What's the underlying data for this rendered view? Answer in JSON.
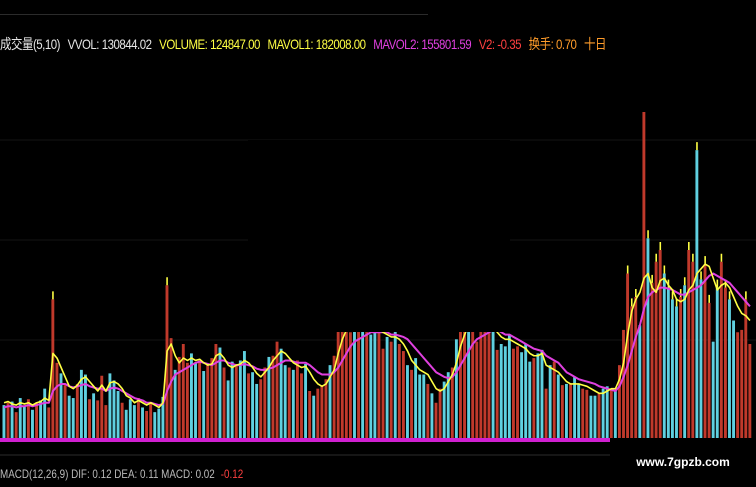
{
  "legend": {
    "indicator": "成交量(5,10)",
    "vvol": "VVOL: 130844.02",
    "volume": "VOLUME: 124847.00",
    "mavol1": "MAVOL1: 182008.00",
    "mavol2": "MAVOL2: 155801.59",
    "v2": "V2: -0.35",
    "turnover": "换手: 0.70",
    "ten_day": "十日"
  },
  "bottom_legend": {
    "label": "MACD(12,26,9) DIF: 0.12 DEA: 0.11 MACD: 0.02",
    "extra": "-0.12"
  },
  "watermark": "www.7gpzb.com",
  "colors": {
    "background": "#000000",
    "up_bar": "#c0392b",
    "down_bar": "#5fd0e0",
    "ma_short": "#ffff44",
    "ma_long": "#e040e0",
    "baseline": "#d020d0",
    "spike": "#ffff44",
    "legend_white": "#e6e6e6",
    "legend_yellow": "#ffff44",
    "legend_magenta": "#e040e0",
    "legend_red": "#ff4040",
    "legend_orange": "#ff9c2a"
  },
  "chart_data": {
    "type": "bar",
    "title": "",
    "xlabel": "",
    "ylabel": "",
    "ylim": [
      0,
      320
    ],
    "grid": true,
    "series": [
      {
        "name": "VOLUME",
        "values": [
          28,
          30,
          31,
          22,
          34,
          27,
          33,
          24,
          30,
          32,
          42,
          26,
          118,
          64,
          55,
          45,
          36,
          34,
          46,
          58,
          54,
          33,
          38,
          32,
          53,
          28,
          55,
          49,
          40,
          30,
          24,
          33,
          28,
          34,
          26,
          23,
          30,
          22,
          25,
          35,
          130,
          85,
          58,
          69,
          80,
          64,
          72,
          64,
          66,
          57,
          62,
          68,
          80,
          77,
          60,
          49,
          65,
          63,
          66,
          74,
          55,
          56,
          46,
          50,
          60,
          69,
          70,
          82,
          76,
          62,
          60,
          58,
          66,
          55,
          63,
          40,
          36,
          42,
          45,
          50,
          62,
          70,
          95,
          98,
          105,
          90,
          95,
          100,
          102,
          98,
          88,
          92,
          92,
          76,
          86,
          82,
          92,
          80,
          74,
          62,
          58,
          68,
          54,
          54,
          46,
          38,
          30,
          42,
          48,
          56,
          60,
          84,
          92,
          102,
          104,
          92,
          82,
          104,
          102,
          100,
          93,
          75,
          80,
          78,
          88,
          76,
          78,
          73,
          80,
          65,
          68,
          72,
          75,
          42,
          62,
          65,
          54,
          45,
          46,
          46,
          52,
          46,
          42,
          41,
          36,
          36,
          38,
          42,
          44,
          42,
          40,
          62,
          92,
          140,
          112,
          120,
          96,
          280,
          170,
          132,
          150,
          160,
          140,
          128,
          118,
          112,
          120,
          130,
          160,
          150,
          245,
          135,
          148,
          115,
          82,
          128,
          150,
          128,
          118,
          100,
          90,
          92,
          118,
          80
        ],
        "up": [
          0,
          1,
          0,
          1,
          0,
          0,
          1,
          0,
          1,
          0,
          0,
          1,
          1,
          1,
          0,
          1,
          0,
          0,
          1,
          0,
          0,
          1,
          0,
          1,
          1,
          1,
          0,
          0,
          0,
          1,
          0,
          0,
          0,
          1,
          0,
          1,
          1,
          0,
          0,
          0,
          1,
          1,
          0,
          1,
          1,
          1,
          0,
          0,
          1,
          0,
          1,
          1,
          1,
          0,
          1,
          0,
          0,
          1,
          0,
          0,
          1,
          0,
          0,
          1,
          1,
          0,
          1,
          1,
          0,
          0,
          1,
          0,
          1,
          1,
          0,
          1,
          0,
          1,
          1,
          1,
          0,
          1,
          1,
          1,
          1,
          1,
          0,
          1,
          0,
          1,
          0,
          0,
          1,
          1,
          0,
          1,
          0,
          1,
          1,
          0,
          1,
          0,
          0,
          0,
          1,
          0,
          1,
          1,
          0,
          0,
          1,
          0,
          1,
          1,
          0,
          1,
          1,
          1,
          1,
          1,
          0,
          1,
          0,
          0,
          0,
          1,
          1,
          0,
          0,
          0,
          1,
          0,
          0,
          1,
          0,
          1,
          0,
          1,
          0,
          1,
          0,
          0,
          1,
          1,
          0,
          0,
          1,
          0,
          0,
          1,
          0,
          1,
          1,
          1,
          1,
          1,
          0,
          1,
          0,
          1,
          1,
          1,
          0,
          0,
          0,
          0,
          1,
          0,
          1,
          1,
          0,
          0,
          1,
          1,
          0,
          0,
          1,
          1,
          0,
          0,
          1,
          1,
          1,
          1
        ]
      },
      {
        "name": "MAVOL1",
        "values": [
          30,
          31,
          29,
          28,
          30,
          29,
          30,
          28,
          30,
          31,
          34,
          32,
          72,
          68,
          60,
          52,
          44,
          42,
          45,
          50,
          52,
          48,
          44,
          40,
          45,
          40,
          47,
          48,
          46,
          42,
          36,
          34,
          30,
          32,
          30,
          28,
          30,
          28,
          26,
          30,
          74,
          80,
          70,
          64,
          68,
          66,
          68,
          66,
          67,
          64,
          62,
          63,
          70,
          72,
          68,
          62,
          60,
          62,
          63,
          66,
          64,
          60,
          55,
          52,
          56,
          60,
          66,
          70,
          74,
          72,
          68,
          64,
          62,
          60,
          61,
          56,
          50,
          46,
          44,
          46,
          52,
          58,
          72,
          84,
          92,
          96,
          98,
          96,
          98,
          98,
          96,
          94,
          92,
          90,
          88,
          86,
          86,
          84,
          80,
          74,
          66,
          62,
          58,
          56,
          54,
          48,
          42,
          40,
          42,
          48,
          54,
          64,
          78,
          88,
          96,
          98,
          94,
          92,
          94,
          96,
          94,
          90,
          86,
          84,
          84,
          82,
          80,
          78,
          76,
          72,
          70,
          70,
          72,
          62,
          60,
          58,
          56,
          52,
          48,
          46,
          46,
          46,
          45,
          44,
          42,
          40,
          38,
          38,
          40,
          42,
          42,
          50,
          64,
          88,
          108,
          118,
          124,
          136,
          140,
          128,
          124,
          134,
          136,
          130,
          126,
          118,
          116,
          118,
          126,
          130,
          140,
          144,
          148,
          146,
          136,
          126,
          130,
          132,
          128,
          120,
          112,
          106,
          104,
          100
        ]
      },
      {
        "name": "MAVOL2",
        "values": [
          26,
          27,
          27,
          26,
          27,
          27,
          28,
          27,
          28,
          29,
          30,
          30,
          40,
          44,
          46,
          46,
          44,
          43,
          44,
          45,
          46,
          44,
          43,
          42,
          42,
          40,
          42,
          43,
          42,
          40,
          38,
          36,
          34,
          33,
          32,
          30,
          30,
          29,
          28,
          29,
          40,
          48,
          54,
          56,
          58,
          60,
          62,
          64,
          65,
          64,
          63,
          62,
          64,
          66,
          66,
          64,
          63,
          62,
          62,
          63,
          62,
          61,
          59,
          58,
          58,
          59,
          60,
          62,
          64,
          66,
          66,
          65,
          64,
          64,
          64,
          62,
          59,
          56,
          54,
          54,
          54,
          56,
          60,
          66,
          72,
          78,
          82,
          84,
          86,
          88,
          90,
          90,
          90,
          90,
          90,
          88,
          88,
          87,
          86,
          84,
          80,
          76,
          72,
          68,
          64,
          60,
          56,
          54,
          52,
          51,
          52,
          56,
          62,
          68,
          74,
          80,
          84,
          86,
          88,
          90,
          92,
          92,
          90,
          88,
          88,
          86,
          84,
          82,
          80,
          78,
          76,
          75,
          74,
          70,
          68,
          66,
          64,
          60,
          56,
          54,
          52,
          50,
          49,
          48,
          47,
          46,
          44,
          43,
          42,
          41,
          40,
          44,
          52,
          62,
          74,
          86,
          96,
          110,
          120,
          124,
          126,
          128,
          128,
          127,
          126,
          124,
          122,
          122,
          124,
          126,
          128,
          130,
          134,
          138,
          140,
          138,
          136,
          134,
          132,
          128,
          124,
          120,
          116,
          112
        ]
      }
    ]
  }
}
